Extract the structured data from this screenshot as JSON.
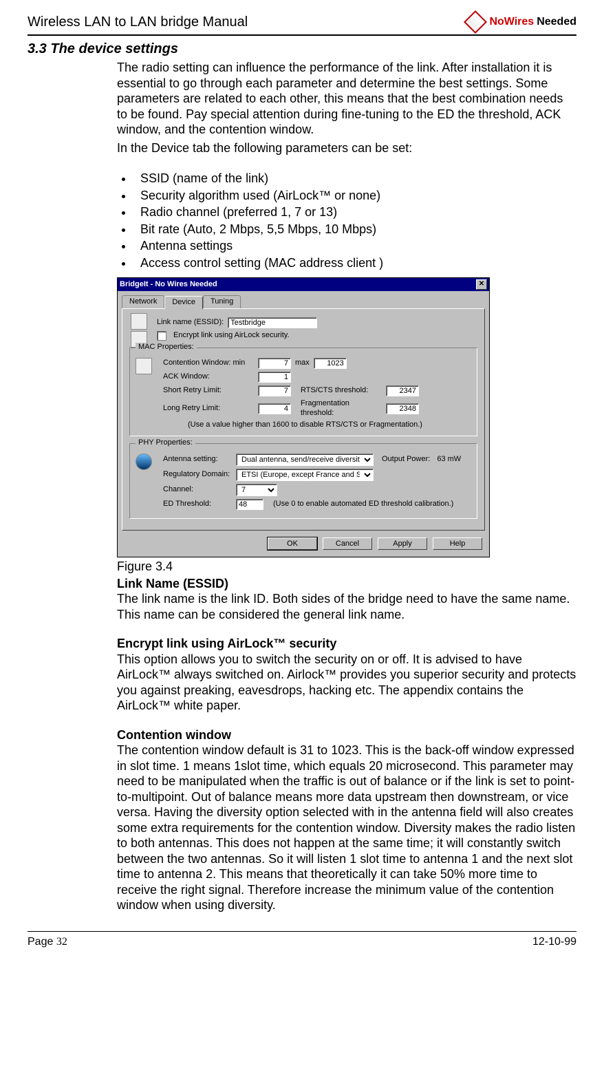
{
  "header": {
    "doc_title": "Wireless LAN to LAN bridge Manual",
    "logo_text_1": "NoWires",
    "logo_text_2": "Needed"
  },
  "section": {
    "number_title": "3.3 The device settings",
    "intro_p1": "The radio setting can influence the performance of the link. After installation it is essential to go through each parameter and determine the best settings. Some parameters are related to each other, this means that the best combination needs to be found. Pay special attention during fine-tuning to the ED the threshold, ACK window, and the contention window.",
    "intro_p2": "In the Device tab the following parameters can be set:",
    "bullets": [
      "SSID (name of the link)",
      "Security algorithm used (AirLock™ or none)",
      "Radio channel (preferred 1, 7 or 13)",
      "Bit rate (Auto, 2 Mbps, 5,5 Mbps, 10 Mbps)",
      "Antenna settings",
      "Access control setting (MAC address client )"
    ],
    "figure_caption": "Figure 3.4",
    "sub1_title": "Link Name (ESSID)",
    "sub1_body": "The link name is the link ID. Both sides of the bridge need to have the same name. This name can be considered the general link name.",
    "sub2_title": "Encrypt link using AirLock™ security",
    "sub2_body": "This option allows you to switch the security on or off. It is advised to have AirLock™ always switched on. Airlock™ provides you superior security and protects you against preaking, eavesdrops, hacking etc. The appendix contains the AirLock™ white paper.",
    "sub3_title": "Contention window",
    "sub3_body": "The contention window default is 31 to 1023. This is the back-off window expressed in slot time. 1 means 1slot time, which equals 20 microsecond. This parameter may need to be manipulated when the traffic is out of balance or if the link is set to point-to-multipoint. Out of balance means more data upstream then downstream, or vice versa. Having the diversity option selected with in the antenna field will also creates some extra requirements for the contention window. Diversity makes the radio listen to both antennas. This does not happen at the same time; it will constantly switch between the two antennas. So it will listen 1 slot time to antenna 1 and the next slot time to antenna 2. This means that theoretically it can take 50% more time to receive the right signal. Therefore increase the minimum value of the contention window when using diversity."
  },
  "dialog": {
    "title": "BridgeIt - No Wires Needed",
    "tabs": {
      "network": "Network",
      "device": "Device",
      "tuning": "Tuning"
    },
    "link_name_label": "Link name (ESSID):",
    "link_name_value": "Testbridge",
    "encrypt_label": "Encrypt link using AirLock security.",
    "mac_group": "MAC Properties:",
    "cw_label": "Contention Window:   min",
    "cw_min": "7",
    "cw_max_label": "max",
    "cw_max": "1023",
    "ack_label": "ACK Window:",
    "ack_value": "1",
    "short_retry_label": "Short Retry Limit:",
    "short_retry_value": "7",
    "rts_label": "RTS/CTS threshold:",
    "rts_value": "2347",
    "long_retry_label": "Long Retry Limit:",
    "long_retry_value": "4",
    "frag_label": "Fragmentation threshold:",
    "frag_value": "2348",
    "mac_note": "(Use a value higher than 1600 to disable RTS/CTS or Fragmentation.)",
    "phy_group": "PHY Properties:",
    "antenna_label": "Antenna setting:",
    "antenna_value": "Dual antenna, send/receive diversity",
    "output_power_label": "Output Power:",
    "output_power_value": "63 mW",
    "reg_label": "Regulatory Domain:",
    "reg_value": "ETSI (Europe, except France and Spain)",
    "chan_label": "Channel:",
    "chan_value": "7",
    "ed_label": "ED Threshold:",
    "ed_value": "48",
    "ed_note": "(Use 0 to enable automated ED threshold calibration.)",
    "buttons": {
      "ok": "OK",
      "cancel": "Cancel",
      "apply": "Apply",
      "help": "Help"
    }
  },
  "footer": {
    "page_label": "Page ",
    "page_num": "32",
    "date": "12-10-99"
  }
}
